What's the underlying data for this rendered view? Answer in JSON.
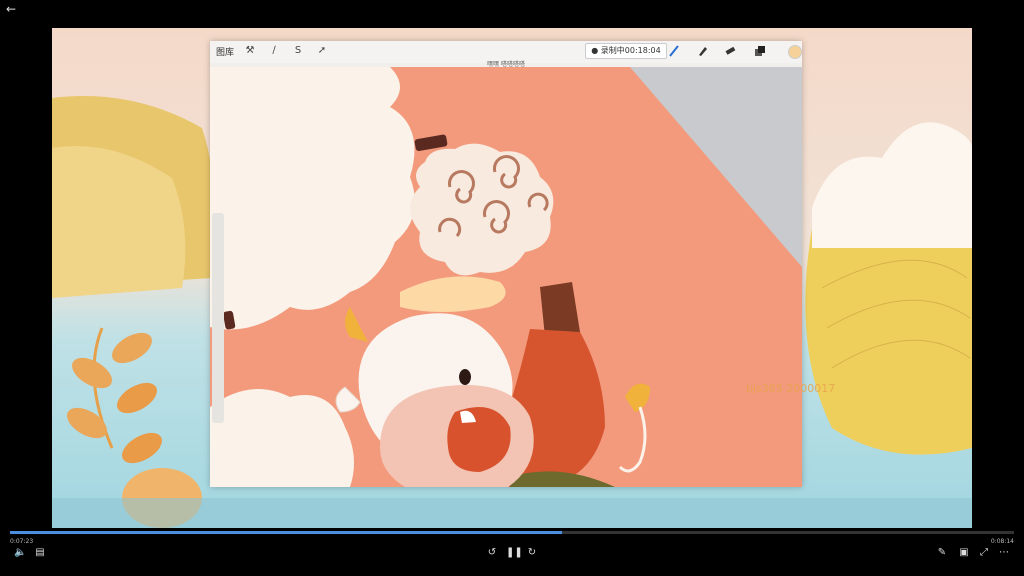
{
  "app": {
    "gallery_label": "图库",
    "recording_label": "● 录制中00:18:04",
    "canvas_title": "嘿嘿 嗒嗒嗒嗒"
  },
  "watermark": "bjs365 2000017",
  "player": {
    "current_time": "0:07:23",
    "total_time": "0:08:14",
    "progress_fraction": 0.55
  },
  "colors": {
    "canvas_bg": "#f39a7d",
    "cloud": "#fbf2ea",
    "progress": "#4a8fe0"
  }
}
